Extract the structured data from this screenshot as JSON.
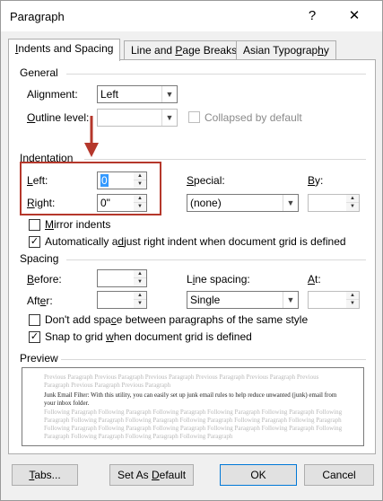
{
  "window": {
    "title": "Paragraph",
    "help_label": "?",
    "close_label": "✕"
  },
  "tabs": [
    {
      "label": "Indents and Spacing",
      "underline": "I",
      "rest": "ndents and Spacing",
      "active": true
    },
    {
      "label": "Line and Page Breaks",
      "pre": "Line and ",
      "underline": "P",
      "rest": "age Breaks"
    },
    {
      "label": "Asian Typography",
      "pre": "Asian Typograp",
      "underline": "h",
      "rest": "y"
    }
  ],
  "general": {
    "title": "General",
    "alignment_label": {
      "pre": "Ali",
      "underline": "g",
      "rest": "nment:"
    },
    "alignment_value": "Left",
    "outline_label": {
      "underline": "O",
      "rest": "utline level:"
    },
    "outline_value": "",
    "collapsed_label": "Collapsed by default"
  },
  "indentation": {
    "title": "Indentation",
    "left_label": {
      "underline": "L",
      "rest": "eft:"
    },
    "left_value": "0",
    "right_label": {
      "underline": "R",
      "rest": "ight:"
    },
    "right_value": "0\"",
    "special_label": {
      "underline": "S",
      "rest": "pecial:"
    },
    "special_value": "(none)",
    "by_label": {
      "underline": "B",
      "rest": "y:"
    },
    "by_value": "",
    "mirror_label": {
      "underline": "M",
      "rest": "irror indents"
    },
    "auto_adjust_label": {
      "pre": "Automatically a",
      "underline": "d",
      "rest": "just right indent when document grid is defined"
    }
  },
  "spacing": {
    "title": "Spacing",
    "before_label": {
      "underline": "B",
      "rest": "efore:"
    },
    "before_value": "",
    "after_label": {
      "pre": "Aft",
      "underline": "e",
      "rest": "r:"
    },
    "after_value": "",
    "line_spacing_label": {
      "pre": "L",
      "underline": "i",
      "rest": "ne spacing:"
    },
    "line_spacing_value": "Single",
    "at_label": {
      "underline": "A",
      "rest": "t:"
    },
    "at_value": "",
    "no_space_label": {
      "pre": "Don't add spa",
      "underline": "c",
      "rest": "e between paragraphs of the same style"
    },
    "snap_label": {
      "pre": "Snap to grid ",
      "underline": "w",
      "rest": "hen document grid is defined"
    }
  },
  "preview": {
    "title": "Preview",
    "previous_text": "Previous Paragraph Previous Paragraph Previous Paragraph Previous Paragraph Previous Paragraph Previous Paragraph Previous Paragraph Previous Paragraph",
    "current_text": "Junk Email Filter: With this utility, you can easily set up junk email rules to help reduce unwanted (junk) email from your inbox folder.",
    "following_text": "Following Paragraph Following Paragraph Following Paragraph Following Paragraph Following Paragraph Following Paragraph Following Paragraph Following Paragraph Following Paragraph Following Paragraph Following Paragraph Following Paragraph Following Paragraph Following Paragraph Following Paragraph Following Paragraph Following Paragraph Following Paragraph Following Paragraph Following Paragraph"
  },
  "buttons": {
    "tabs": {
      "underline": "T",
      "rest": "abs..."
    },
    "set_default": {
      "pre": "Set As ",
      "underline": "D",
      "rest": "efault"
    },
    "ok": "OK",
    "cancel": "Cancel"
  },
  "colors": {
    "accent": "#0078d7",
    "highlight": "#b5372b",
    "selection": "#3399ff"
  }
}
